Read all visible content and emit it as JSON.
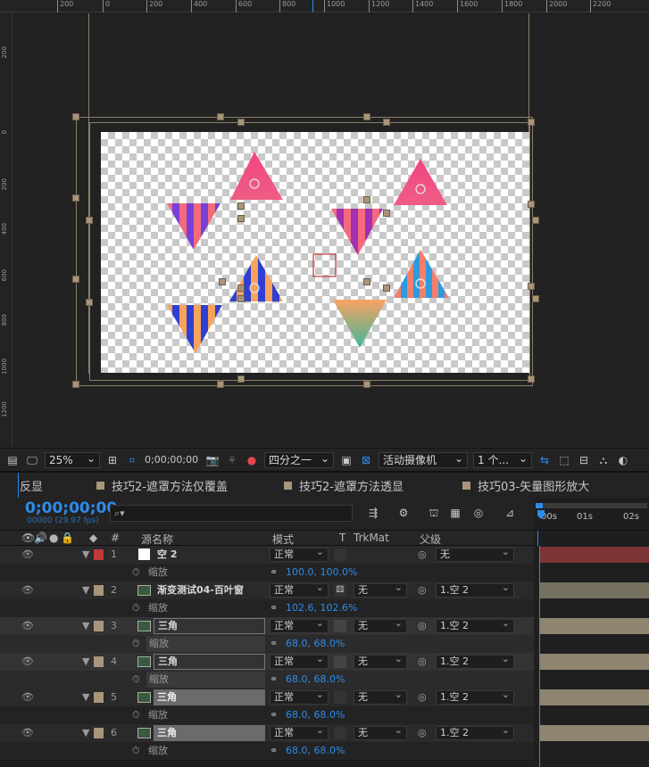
{
  "ruler_top": [
    "200",
    "0",
    "200",
    "400",
    "600",
    "800",
    "1000",
    "1200",
    "1400",
    "1600",
    "1800",
    "2000",
    "2200"
  ],
  "ruler_left": [
    "200",
    "0",
    "200",
    "400",
    "600",
    "800",
    "1000",
    "1200"
  ],
  "viewer_toolbar": {
    "zoom": "25%",
    "timecode": "0;00;00;00",
    "resolution": "四分之一",
    "camera": "活动摄像机",
    "views": "1 个..."
  },
  "tabs": [
    {
      "label": "反显"
    },
    {
      "label": "技巧2-遮罩方法仅覆盖"
    },
    {
      "label": "技巧2-遮罩方法透显"
    },
    {
      "label": "技巧03-矢量图形放大"
    }
  ],
  "timeline": {
    "current_time": "0;00;00;00",
    "frame_info": "00000 (29.97 fps)",
    "search_placeholder": "",
    "time_marks": [
      "00s",
      "01s",
      "02s"
    ]
  },
  "columns": {
    "number": "#",
    "source_name": "源名称",
    "mode": "模式",
    "t": "T",
    "trkmat": "TrkMat",
    "parent": "父级"
  },
  "layers": [
    {
      "num": "1",
      "name": "空 2",
      "color": "#c0393b",
      "mode": "正常",
      "trkmat": "",
      "parent": "无",
      "prop_label": "缩放",
      "prop_value": "100.0, 100.0%",
      "thumb": "white"
    },
    {
      "num": "2",
      "name": "渐变测试04-百叶窗",
      "color": "#a8957a",
      "mode": "正常",
      "trkmat": "无",
      "parent": "1.空 2",
      "prop_label": "缩放",
      "prop_value": "102.6, 102.6%",
      "thumb": "comp"
    },
    {
      "num": "3",
      "name": "三角",
      "color": "#a8957a",
      "mode": "正常",
      "trkmat": "无",
      "parent": "1.空 2",
      "prop_label": "缩放",
      "prop_value": "68.0, 68.0%",
      "thumb": "comp"
    },
    {
      "num": "4",
      "name": "三角",
      "color": "#a8957a",
      "mode": "正常",
      "trkmat": "无",
      "parent": "1.空 2",
      "prop_label": "缩放",
      "prop_value": "68.0, 68.0%",
      "thumb": "comp"
    },
    {
      "num": "5",
      "name": "三角",
      "color": "#a8957a",
      "mode": "正常",
      "trkmat": "无",
      "parent": "1.空 2",
      "prop_label": "缩放",
      "prop_value": "68.0, 68.0%",
      "thumb": "comp"
    },
    {
      "num": "6",
      "name": "三角",
      "color": "#a8957a",
      "mode": "正常",
      "trkmat": "无",
      "parent": "1.空 2",
      "prop_label": "缩放",
      "prop_value": "68.0, 68.0%",
      "thumb": "comp"
    }
  ],
  "colors": {
    "accent": "#2d8ceb",
    "label_red": "#c0393b",
    "label_sand": "#a8957a",
    "track_red": "#7d3434",
    "track_sand": "#8f846f"
  }
}
